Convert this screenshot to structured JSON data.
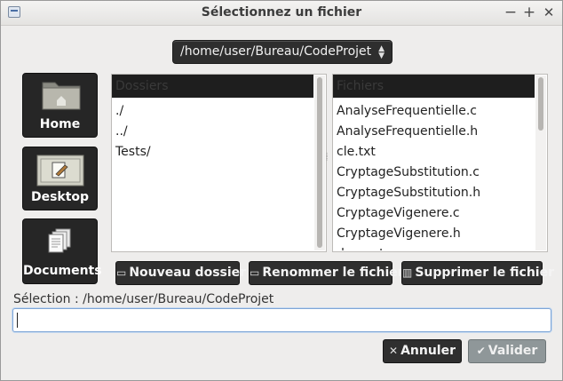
{
  "window": {
    "title": "Sélectionnez un fichier",
    "app_icon": "file-dialog-icon",
    "controls": {
      "minimize": "−",
      "maximize": "+",
      "close": "✕"
    }
  },
  "path_selector": {
    "value": "/home/user/Bureau/CodeProjet",
    "icon": "updown-arrows-icon"
  },
  "places": [
    {
      "label": "Home",
      "icon": "home-folder-icon"
    },
    {
      "label": "Desktop",
      "icon": "desktop-icon"
    },
    {
      "label": "Documents",
      "icon": "documents-icon"
    }
  ],
  "folders": {
    "header": "Dossiers",
    "items": [
      "./",
      "../",
      "Tests/"
    ]
  },
  "files": {
    "header": "Fichiers",
    "items": [
      "AnalyseFrequentielle.c",
      "AnalyseFrequentielle.h",
      "cle.txt",
      "CryptageSubstitution.c",
      "CryptageSubstitution.h",
      "CryptageVigenere.c",
      "CryptageVigenere.h",
      "decrypt"
    ]
  },
  "actions": {
    "new_folder": "Nouveau dossier",
    "rename_file": "Renommer le fichier",
    "delete_file": "Supprimer le fichier"
  },
  "selection": {
    "label": "Sélection : /home/user/Bureau/CodeProjet",
    "value": ""
  },
  "buttons": {
    "cancel": "Annuler",
    "ok": "Valider"
  }
}
